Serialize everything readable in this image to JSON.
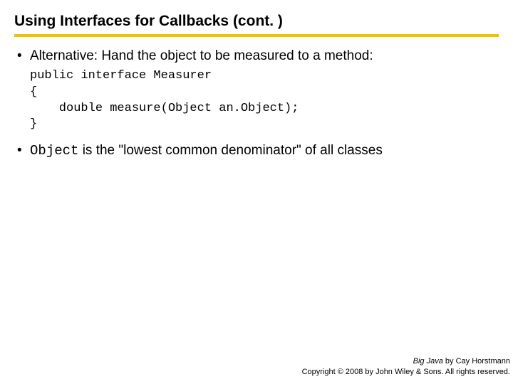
{
  "title": "Using Interfaces for Callbacks  (cont. )",
  "bullets": {
    "b1_text": "Alternative: Hand the object to be measured to a method:",
    "b1_code": "public interface Measurer\n{\n    double measure(Object an.Object);\n}",
    "b2_code_word": "Object",
    "b2_rest": " is the \"lowest common denominator\" of all classes"
  },
  "footer": {
    "line1_book": "Big Java",
    "line1_rest": " by Cay Horstmann",
    "line2": "Copyright © 2008 by John Wiley & Sons.  All rights reserved."
  }
}
